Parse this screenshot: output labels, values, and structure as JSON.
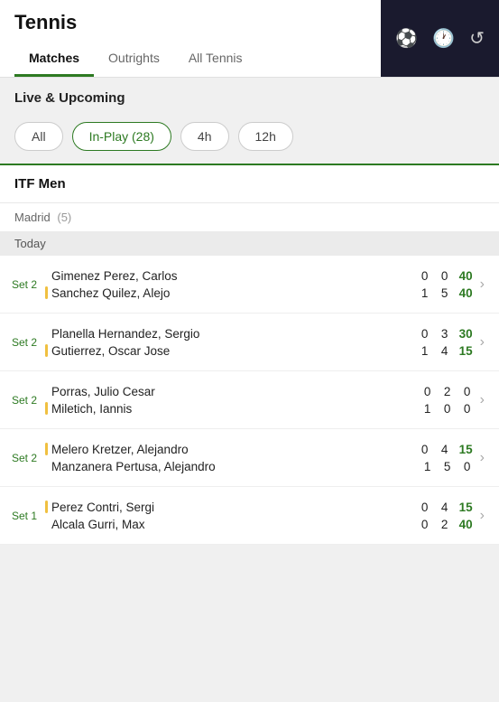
{
  "header": {
    "title": "Tennis",
    "tabs": [
      {
        "label": "Matches",
        "active": true
      },
      {
        "label": "Outrights",
        "active": false
      },
      {
        "label": "All Tennis",
        "active": false
      }
    ],
    "icons": [
      "⚽",
      "🕐",
      "↺"
    ]
  },
  "section": {
    "title": "Live & Upcoming"
  },
  "filters": [
    {
      "label": "All",
      "active": false
    },
    {
      "label": "In-Play (28)",
      "active": true
    },
    {
      "label": "4h",
      "active": false
    },
    {
      "label": "12h",
      "active": false
    }
  ],
  "competitions": [
    {
      "name": "ITF Men",
      "sub": "Madrid",
      "count": "(5)",
      "day": "Today",
      "matches": [
        {
          "set": "Set 2",
          "players": [
            {
              "name": "Gimenez Perez, Carlos",
              "serving": false
            },
            {
              "name": "Sanchez Quilez, Alejo",
              "serving": true
            }
          ],
          "scores": [
            [
              {
                "val": "0",
                "green": false
              },
              {
                "val": "0",
                "green": false
              },
              {
                "val": "40",
                "green": true
              }
            ],
            [
              {
                "val": "1",
                "green": false
              },
              {
                "val": "5",
                "green": false
              },
              {
                "val": "40",
                "green": true
              }
            ]
          ]
        },
        {
          "set": "Set 2",
          "players": [
            {
              "name": "Planella Hernandez, Sergio",
              "serving": false
            },
            {
              "name": "Gutierrez, Oscar Jose",
              "serving": true
            }
          ],
          "scores": [
            [
              {
                "val": "0",
                "green": false
              },
              {
                "val": "3",
                "green": false
              },
              {
                "val": "30",
                "green": true
              }
            ],
            [
              {
                "val": "1",
                "green": false
              },
              {
                "val": "4",
                "green": false
              },
              {
                "val": "15",
                "green": true
              }
            ]
          ]
        },
        {
          "set": "Set 2",
          "players": [
            {
              "name": "Porras, Julio Cesar",
              "serving": false
            },
            {
              "name": "Miletich, Iannis",
              "serving": true
            }
          ],
          "scores": [
            [
              {
                "val": "0",
                "green": false
              },
              {
                "val": "2",
                "green": false
              },
              {
                "val": "0",
                "green": false
              }
            ],
            [
              {
                "val": "1",
                "green": false
              },
              {
                "val": "0",
                "green": false
              },
              {
                "val": "0",
                "green": false
              }
            ]
          ]
        },
        {
          "set": "Set 2",
          "players": [
            {
              "name": "Melero Kretzer, Alejandro",
              "serving": true
            },
            {
              "name": "Manzanera Pertusa, Alejandro",
              "serving": false
            }
          ],
          "scores": [
            [
              {
                "val": "0",
                "green": false
              },
              {
                "val": "4",
                "green": false
              },
              {
                "val": "15",
                "green": true
              }
            ],
            [
              {
                "val": "1",
                "green": false
              },
              {
                "val": "5",
                "green": false
              },
              {
                "val": "0",
                "green": false
              }
            ]
          ]
        },
        {
          "set": "Set 1",
          "players": [
            {
              "name": "Perez Contri, Sergi",
              "serving": true
            },
            {
              "name": "Alcala Gurri, Max",
              "serving": false
            }
          ],
          "scores": [
            [
              {
                "val": "0",
                "green": false
              },
              {
                "val": "4",
                "green": false
              },
              {
                "val": "15",
                "green": true
              }
            ],
            [
              {
                "val": "0",
                "green": false
              },
              {
                "val": "2",
                "green": false
              },
              {
                "val": "40",
                "green": true
              }
            ]
          ]
        }
      ]
    }
  ]
}
